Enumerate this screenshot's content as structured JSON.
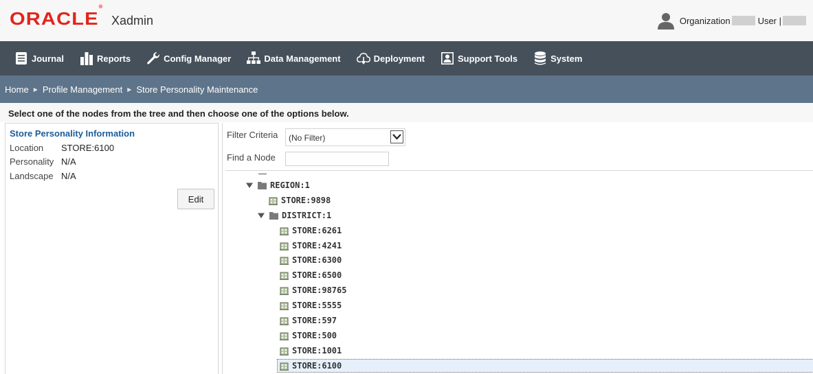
{
  "header": {
    "brand": "ORACLE",
    "app_name": "Xadmin",
    "organization_label": "Organization",
    "user_label": "User |"
  },
  "nav": {
    "journal": "Journal",
    "reports": "Reports",
    "config_manager": "Config Manager",
    "data_management": "Data Management",
    "deployment": "Deployment",
    "support_tools": "Support Tools",
    "system": "System"
  },
  "breadcrumb": {
    "home": "Home",
    "profile_management": "Profile Management",
    "store_personality": "Store Personality Maintenance"
  },
  "instruction": "Select one of the nodes from the tree and then choose one of the options below.",
  "info_panel": {
    "title": "Store Personality Information",
    "location_label": "Location",
    "location_value": "STORE:6100",
    "personality_label": "Personality",
    "personality_value": "N/A",
    "landscape_label": "Landscape",
    "landscape_value": "N/A",
    "edit_label": "Edit"
  },
  "tree_panel": {
    "filter_label": "Filter Criteria",
    "filter_value": "(No Filter)",
    "find_label": "Find a Node",
    "find_value": "",
    "nodes": {
      "region": "REGION:1",
      "store_9898": "STORE:9898",
      "district": "DISTRICT:1",
      "store_6261": "STORE:6261",
      "store_4241": "STORE:4241",
      "store_6300": "STORE:6300",
      "store_6500": "STORE:6500",
      "store_98765": "STORE:98765",
      "store_5555": "STORE:5555",
      "store_597": "STORE:597",
      "store_500": "STORE:500",
      "store_1001": "STORE:1001",
      "store_6100": "STORE:6100"
    }
  },
  "colors": {
    "brand_red": "#e2241b",
    "nav_bg": "#46505a",
    "breadcrumb_bg": "#5e748a",
    "link_blue": "#1a5c99",
    "selected_bg": "#e5f0fb"
  }
}
